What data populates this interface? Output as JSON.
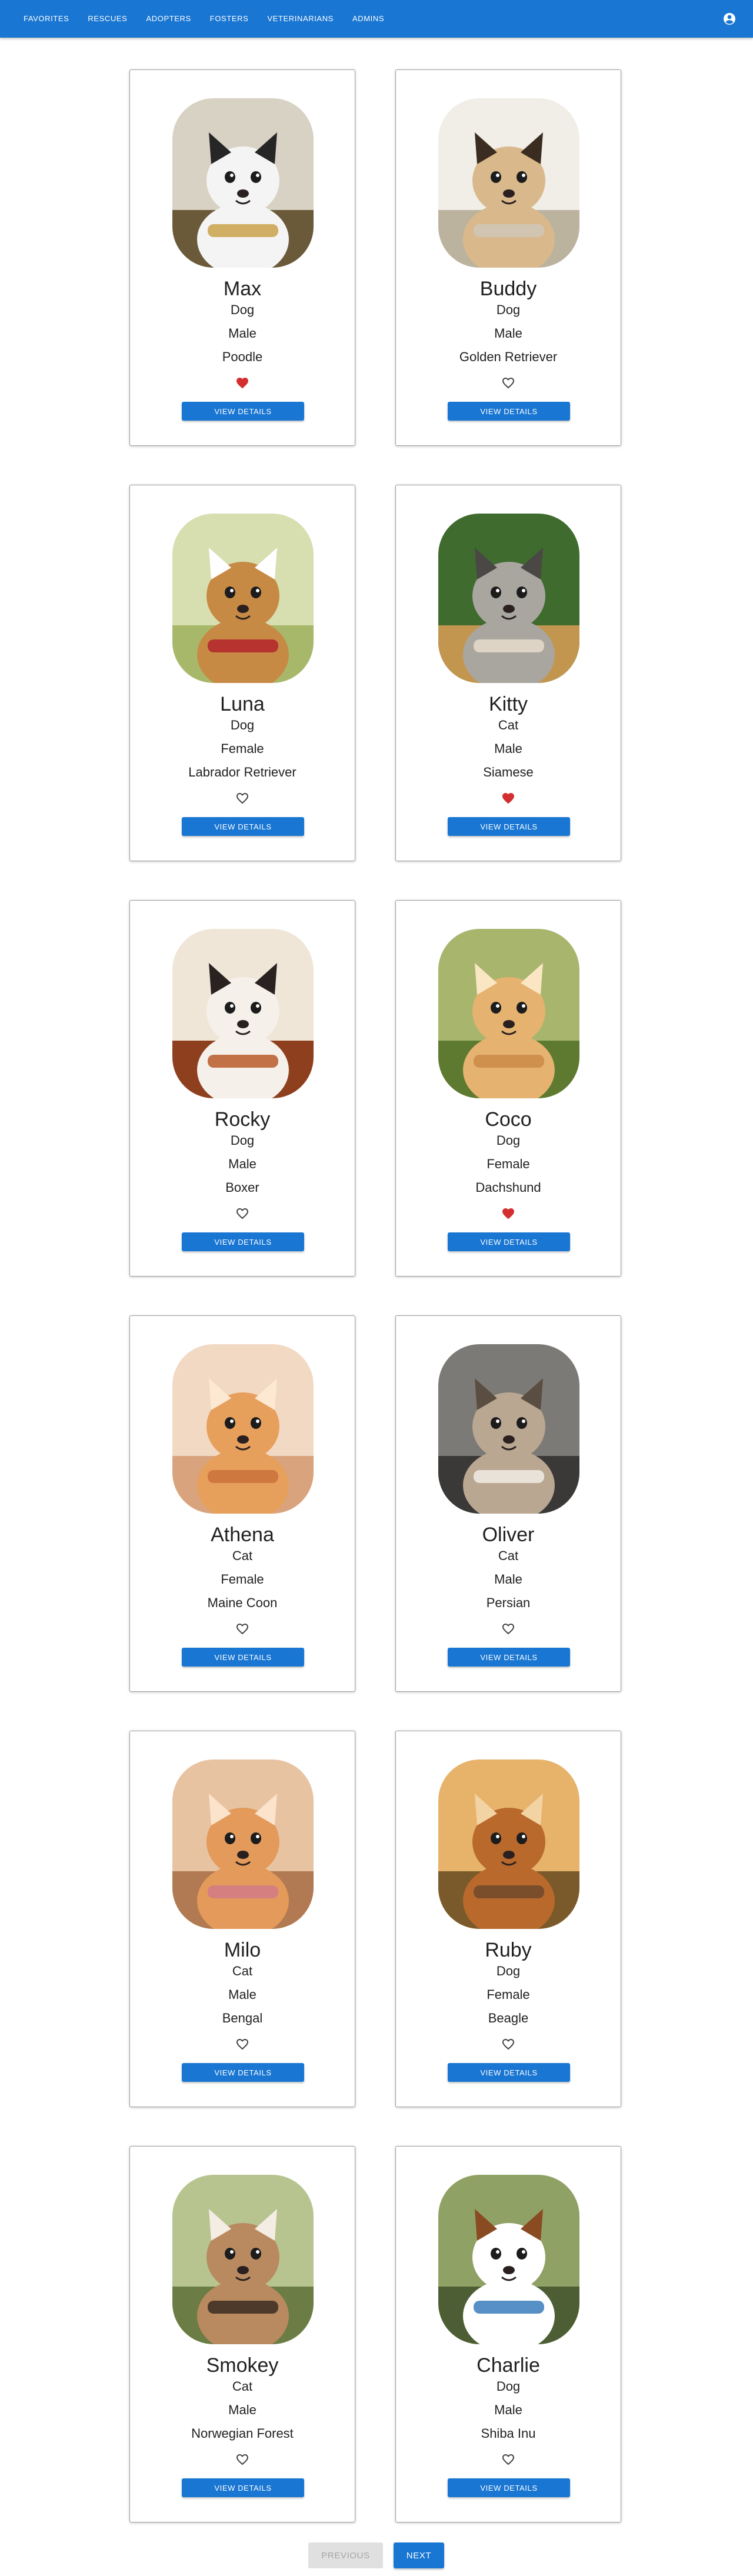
{
  "nav": {
    "items": [
      "Favorites",
      "Rescues",
      "Adopters",
      "Fosters",
      "Veterinarians",
      "Admins"
    ],
    "account_icon": "account-circle-icon"
  },
  "colors": {
    "primary": "#1976d2",
    "favorite": "#d32f2f",
    "disabled_bg": "#e0e0e0",
    "disabled_text": "#a6a6a6"
  },
  "pets": [
    {
      "name": "Max",
      "species": "Dog",
      "gender": "Male",
      "breed": "Poodle",
      "favorited": true,
      "button": "View Details",
      "photo": "husky-puppy-photo"
    },
    {
      "name": "Buddy",
      "species": "Dog",
      "gender": "Male",
      "breed": "Golden Retriever",
      "favorited": false,
      "button": "View Details",
      "photo": "pug-in-hoodie-photo"
    },
    {
      "name": "Luna",
      "species": "Dog",
      "gender": "Female",
      "breed": "Labrador Retriever",
      "favorited": false,
      "button": "View Details",
      "photo": "puppy-red-sweater-photo"
    },
    {
      "name": "Kitty",
      "species": "Cat",
      "gender": "Male",
      "breed": "Siamese",
      "favorited": true,
      "button": "View Details",
      "photo": "tabby-kitten-photo"
    },
    {
      "name": "Rocky",
      "species": "Dog",
      "gender": "Male",
      "breed": "Boxer",
      "favorited": false,
      "button": "View Details",
      "photo": "puppy-in-basket-photo"
    },
    {
      "name": "Coco",
      "species": "Dog",
      "gender": "Female",
      "breed": "Dachshund",
      "favorited": true,
      "button": "View Details",
      "photo": "shiba-puppy-running-photo"
    },
    {
      "name": "Athena",
      "species": "Cat",
      "gender": "Female",
      "breed": "Maine Coon",
      "favorited": false,
      "button": "View Details",
      "photo": "orange-kitten-photo"
    },
    {
      "name": "Oliver",
      "species": "Cat",
      "gender": "Male",
      "breed": "Persian",
      "favorited": false,
      "button": "View Details",
      "photo": "grey-kitten-photo"
    },
    {
      "name": "Milo",
      "species": "Cat",
      "gender": "Male",
      "breed": "Bengal",
      "favorited": false,
      "button": "View Details",
      "photo": "kitten-with-yarn-photo"
    },
    {
      "name": "Ruby",
      "species": "Dog",
      "gender": "Female",
      "breed": "Beagle",
      "favorited": false,
      "button": "View Details",
      "photo": "sitting-puppy-photo"
    },
    {
      "name": "Smokey",
      "species": "Cat",
      "gender": "Male",
      "breed": "Norwegian Forest",
      "favorited": false,
      "button": "View Details",
      "photo": "fluffy-kitten-photo"
    },
    {
      "name": "Charlie",
      "species": "Dog",
      "gender": "Male",
      "breed": "Shiba Inu",
      "favorited": false,
      "button": "View Details",
      "photo": "bulldog-bowtie-photo"
    }
  ],
  "pagination": {
    "previous": "Previous",
    "next": "Next",
    "previous_disabled": true
  }
}
